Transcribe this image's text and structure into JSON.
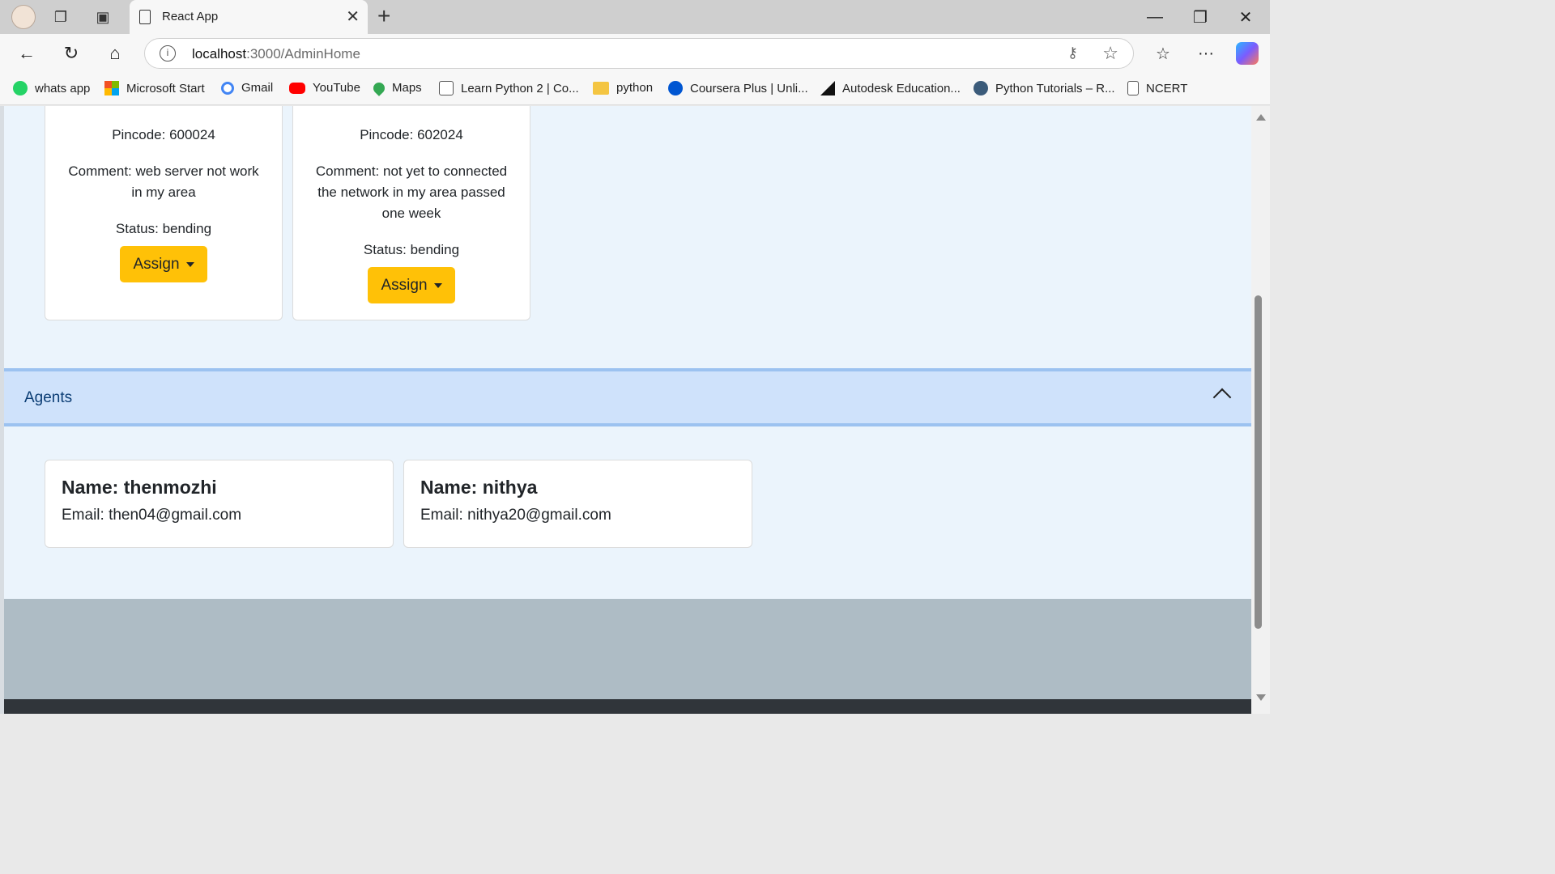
{
  "browser": {
    "tab_title": "React App",
    "url_host": "localhost",
    "url_path": ":3000/AdminHome"
  },
  "bookmarks": [
    {
      "label": "whats app",
      "color": "#25d366"
    },
    {
      "label": "Microsoft Start",
      "color": "#f25022"
    },
    {
      "label": "Gmail",
      "color": "#ea4335"
    },
    {
      "label": "YouTube",
      "color": "#ff0000"
    },
    {
      "label": "Maps",
      "color": "#34a853"
    },
    {
      "label": "Learn Python 2 | Co...",
      "color": "#555555"
    },
    {
      "label": "python",
      "color": "#f4c542"
    },
    {
      "label": "Coursera Plus | Unli...",
      "color": "#0056d2"
    },
    {
      "label": "Autodesk Education...",
      "color": "#111111"
    },
    {
      "label": "Python Tutorials – R...",
      "color": "#3b5b7a"
    },
    {
      "label": "NCERT",
      "color": "#777777"
    }
  ],
  "complaints": [
    {
      "pincode": "Pincode: 600024",
      "comment": "Comment: web server not work in my area",
      "status": "Status: bending",
      "assign_label": "Assign"
    },
    {
      "pincode": "Pincode: 602024",
      "comment": "Comment: not yet to connected the network in my area passed one week",
      "status": "Status: bending",
      "assign_label": "Assign"
    }
  ],
  "agents_section": {
    "title": "Agents"
  },
  "agents": [
    {
      "name": "Name: thenmozhi",
      "email": "Email: then04@gmail.com"
    },
    {
      "name": "Name: nithya",
      "email": "Email: nithya20@gmail.com"
    }
  ],
  "colors": {
    "accent_button": "#ffc107",
    "accordion_bg": "#cfe2fb",
    "page_bg": "#ebf4fc"
  }
}
